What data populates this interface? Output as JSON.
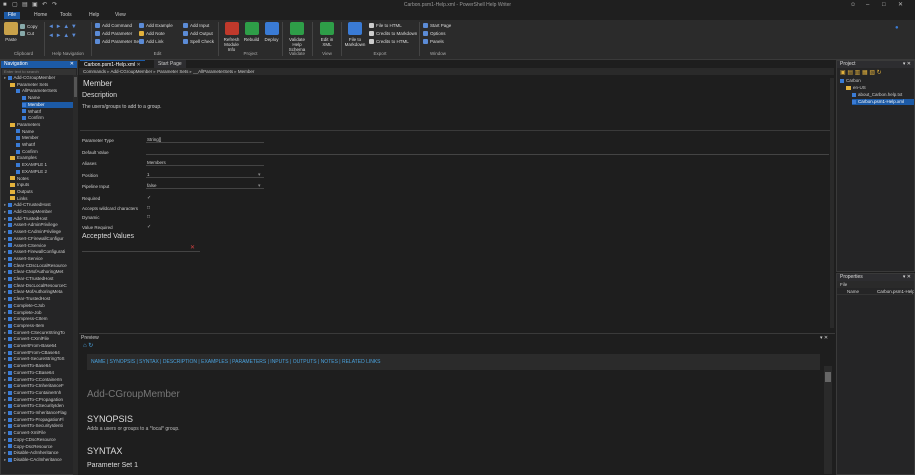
{
  "window": {
    "title": "Carbon.psm1-Help.xml - PowerShell Help Writer"
  },
  "menu": [
    {
      "label": "File",
      "active": true
    },
    {
      "label": "Home",
      "active": false
    },
    {
      "label": "Tools",
      "active": false
    },
    {
      "label": "Help",
      "active": false
    },
    {
      "label": "View",
      "active": false
    }
  ],
  "ribbon": {
    "clipboard": {
      "paste": "Paste",
      "copy": "Copy",
      "cut": "Cut",
      "group": "Clipboard"
    },
    "help_nav": {
      "group": "Help Navigation"
    },
    "edit_buttons": [
      {
        "label": "Add Command",
        "color": "#5b8bd6"
      },
      {
        "label": "Add Parameter",
        "color": "#5b8bd6"
      },
      {
        "label": "Add Parameter Set",
        "color": "#5b8bd6"
      },
      {
        "label": "Add Example",
        "color": "#5b8bd6"
      },
      {
        "label": "Add Note",
        "color": "#e2b13c"
      },
      {
        "label": "Add Link",
        "color": "#5b8bd6"
      },
      {
        "label": "Add Input",
        "color": "#5b8bd6"
      },
      {
        "label": "Add Output",
        "color": "#5b8bd6"
      },
      {
        "label": "Spell Check",
        "color": "#5b8bd6"
      }
    ],
    "edit_group": "Edit",
    "project": [
      {
        "label": "Refresh Module Info",
        "color": "#c0392b"
      },
      {
        "label": "Rebuild",
        "color": "#2e9e48"
      },
      {
        "label": "Deploy",
        "color": "#3a7bd5"
      }
    ],
    "project_group": "Project",
    "validate": {
      "label": "Validate Help Schema",
      "group": "Validate"
    },
    "view": {
      "label": "Edit in XML",
      "group": "View"
    },
    "export": {
      "big": "File to Markdown",
      "items": [
        "File to HTML",
        "Credits to Markdown",
        "Credits to HTML"
      ],
      "group": "Export"
    },
    "window": {
      "items": [
        "Start Page",
        "Options",
        "Panels"
      ],
      "group": "Window"
    }
  },
  "navigation": {
    "title": "Navigation",
    "search_placeholder": "Enter text to search",
    "items": [
      {
        "label": "Add-CGroupMember",
        "indent": 0,
        "kind": "cmd",
        "sel": false
      },
      {
        "label": "Parameter Sets",
        "indent": 1,
        "kind": "folder",
        "sel": false
      },
      {
        "label": "AllParameterSets",
        "indent": 2,
        "kind": "cmd",
        "sel": false
      },
      {
        "label": "Name",
        "indent": 3,
        "kind": "cmd",
        "sel": false
      },
      {
        "label": "Member",
        "indent": 3,
        "kind": "cmd",
        "sel": true
      },
      {
        "label": "WhatIf",
        "indent": 3,
        "kind": "cmd",
        "sel": false
      },
      {
        "label": "Confirm",
        "indent": 3,
        "kind": "cmd",
        "sel": false
      },
      {
        "label": "Parameters",
        "indent": 1,
        "kind": "folder",
        "sel": false
      },
      {
        "label": "Name",
        "indent": 2,
        "kind": "cmd",
        "sel": false
      },
      {
        "label": "Member",
        "indent": 2,
        "kind": "cmd",
        "sel": false
      },
      {
        "label": "WhatIf",
        "indent": 2,
        "kind": "cmd",
        "sel": false
      },
      {
        "label": "Confirm",
        "indent": 2,
        "kind": "cmd",
        "sel": false
      },
      {
        "label": "Examples",
        "indent": 1,
        "kind": "folder",
        "sel": false
      },
      {
        "label": "EXAMPLE 1",
        "indent": 2,
        "kind": "cmd",
        "sel": false
      },
      {
        "label": "EXAMPLE 2",
        "indent": 2,
        "kind": "cmd",
        "sel": false
      },
      {
        "label": "Notes",
        "indent": 1,
        "kind": "folder",
        "sel": false
      },
      {
        "label": "Inputs",
        "indent": 1,
        "kind": "folder",
        "sel": false
      },
      {
        "label": "Outputs",
        "indent": 1,
        "kind": "folder",
        "sel": false
      },
      {
        "label": "Links",
        "indent": 1,
        "kind": "folder",
        "sel": false
      },
      {
        "label": "Add-CTrustedHost",
        "indent": 0,
        "kind": "cmd",
        "sel": false
      },
      {
        "label": "Add-GroupMember",
        "indent": 0,
        "kind": "cmd",
        "sel": false
      },
      {
        "label": "Add-TrustedHost",
        "indent": 0,
        "kind": "cmd",
        "sel": false
      },
      {
        "label": "Assert-AdminPrivilege",
        "indent": 0,
        "kind": "cmd",
        "sel": false
      },
      {
        "label": "Assert-CAdminPrivilege",
        "indent": 0,
        "kind": "cmd",
        "sel": false
      },
      {
        "label": "Assert-CFirewallConfigur",
        "indent": 0,
        "kind": "cmd",
        "sel": false
      },
      {
        "label": "Assert-CService",
        "indent": 0,
        "kind": "cmd",
        "sel": false
      },
      {
        "label": "Assert-FirewallConfigurati",
        "indent": 0,
        "kind": "cmd",
        "sel": false
      },
      {
        "label": "Assert-Service",
        "indent": 0,
        "kind": "cmd",
        "sel": false
      },
      {
        "label": "Clear-CDscLocalResource",
        "indent": 0,
        "kind": "cmd",
        "sel": false
      },
      {
        "label": "Clear-CMofAuthoringMet",
        "indent": 0,
        "kind": "cmd",
        "sel": false
      },
      {
        "label": "Clear-CTrustedHost",
        "indent": 0,
        "kind": "cmd",
        "sel": false
      },
      {
        "label": "Clear-DscLocalResourceC",
        "indent": 0,
        "kind": "cmd",
        "sel": false
      },
      {
        "label": "Clear-MofAuthoringMeta",
        "indent": 0,
        "kind": "cmd",
        "sel": false
      },
      {
        "label": "Clear-TrustedHost",
        "indent": 0,
        "kind": "cmd",
        "sel": false
      },
      {
        "label": "Complete-CJob",
        "indent": 0,
        "kind": "cmd",
        "sel": false
      },
      {
        "label": "Complete-Job",
        "indent": 0,
        "kind": "cmd",
        "sel": false
      },
      {
        "label": "Compress-CItem",
        "indent": 0,
        "kind": "cmd",
        "sel": false
      },
      {
        "label": "Compress-Item",
        "indent": 0,
        "kind": "cmd",
        "sel": false
      },
      {
        "label": "Convert-CSecureStringTo",
        "indent": 0,
        "kind": "cmd",
        "sel": false
      },
      {
        "label": "Convert-CXmlFile",
        "indent": 0,
        "kind": "cmd",
        "sel": false
      },
      {
        "label": "ConvertFrom-Base64",
        "indent": 0,
        "kind": "cmd",
        "sel": false
      },
      {
        "label": "ConvertFrom-CBase64",
        "indent": 0,
        "kind": "cmd",
        "sel": false
      },
      {
        "label": "Convert-SecureStringToS",
        "indent": 0,
        "kind": "cmd",
        "sel": false
      },
      {
        "label": "ConvertTo-Base64",
        "indent": 0,
        "kind": "cmd",
        "sel": false
      },
      {
        "label": "ConvertTo-CBase64",
        "indent": 0,
        "kind": "cmd",
        "sel": false
      },
      {
        "label": "ConvertTo-CContainerIn",
        "indent": 0,
        "kind": "cmd",
        "sel": false
      },
      {
        "label": "ConvertTo-CInheritanceF",
        "indent": 0,
        "kind": "cmd",
        "sel": false
      },
      {
        "label": "ConvertTo-ContainerInh",
        "indent": 0,
        "kind": "cmd",
        "sel": false
      },
      {
        "label": "ConvertTo-CPropagation",
        "indent": 0,
        "kind": "cmd",
        "sel": false
      },
      {
        "label": "ConvertTo-CSecurityIden",
        "indent": 0,
        "kind": "cmd",
        "sel": false
      },
      {
        "label": "ConvertTo-InheritanceFlag",
        "indent": 0,
        "kind": "cmd",
        "sel": false
      },
      {
        "label": "ConvertTo-PropagationFl",
        "indent": 0,
        "kind": "cmd",
        "sel": false
      },
      {
        "label": "ConvertTo-SecurityIdenti",
        "indent": 0,
        "kind": "cmd",
        "sel": false
      },
      {
        "label": "Convert-XmlFile",
        "indent": 0,
        "kind": "cmd",
        "sel": false
      },
      {
        "label": "Copy-CDscResource",
        "indent": 0,
        "kind": "cmd",
        "sel": false
      },
      {
        "label": "Copy-DscResource",
        "indent": 0,
        "kind": "cmd",
        "sel": false
      },
      {
        "label": "Disable-AclInheritance",
        "indent": 0,
        "kind": "cmd",
        "sel": false
      },
      {
        "label": "Disable-CAclInheritance",
        "indent": 0,
        "kind": "cmd",
        "sel": false
      }
    ]
  },
  "tabs": [
    {
      "label": "Carbon.psm1-Help.xml",
      "active": true
    },
    {
      "label": "Start Page",
      "active": false
    }
  ],
  "breadcrumb": [
    "Commands",
    "Add-CGroupMember",
    "Parameter Sets",
    "__AllParameterSets",
    "Member"
  ],
  "editor": {
    "title": "Member",
    "description_heading": "Description",
    "description_text": "The users/groups to add to a group.",
    "fields": [
      {
        "label": "Parameter Type",
        "value": "String[]"
      },
      {
        "label": "Default Value",
        "value": ""
      },
      {
        "label": "Aliases",
        "value": "Members"
      },
      {
        "label": "Position",
        "value": "1"
      },
      {
        "label": "Pipeline Input",
        "value": "false"
      }
    ],
    "checks": [
      {
        "label": "Required",
        "checked": true
      },
      {
        "label": "Accepts wildcard characters",
        "checked": false
      },
      {
        "label": "Dynamic",
        "checked": false
      },
      {
        "label": "Value Required",
        "checked": true
      }
    ],
    "accepted_values": "Accepted Values"
  },
  "preview": {
    "title": "Preview",
    "links": "NAME | SYNOPSIS | SYNTAX | DESCRIPTION | EXAMPLES | PARAMETERS | INPUTS | OUTPUTS | NOTES | RELATED LINKS",
    "cmd_title": "Add-CGroupMember",
    "synopsis_heading": "SYNOPSIS",
    "synopsis_text": "Adds a users or groups to a *local* group.",
    "syntax_heading": "SYNTAX",
    "param_set": "Parameter Set 1"
  },
  "project": {
    "title": "Project",
    "items": [
      {
        "label": "Carbon",
        "indent": 0
      },
      {
        "label": "en-US",
        "indent": 1
      },
      {
        "label": "about_Carbon.help.txt",
        "indent": 2
      },
      {
        "label": "Carbon.psm1-Help.xml",
        "indent": 2
      }
    ]
  },
  "properties": {
    "title": "Properties",
    "section": "File",
    "rows": [
      {
        "k": "Name",
        "v": "Carbon.psm1-Help.xml"
      }
    ]
  },
  "colors": {
    "accent": "#1c5aa6",
    "link": "#4aa3df"
  }
}
